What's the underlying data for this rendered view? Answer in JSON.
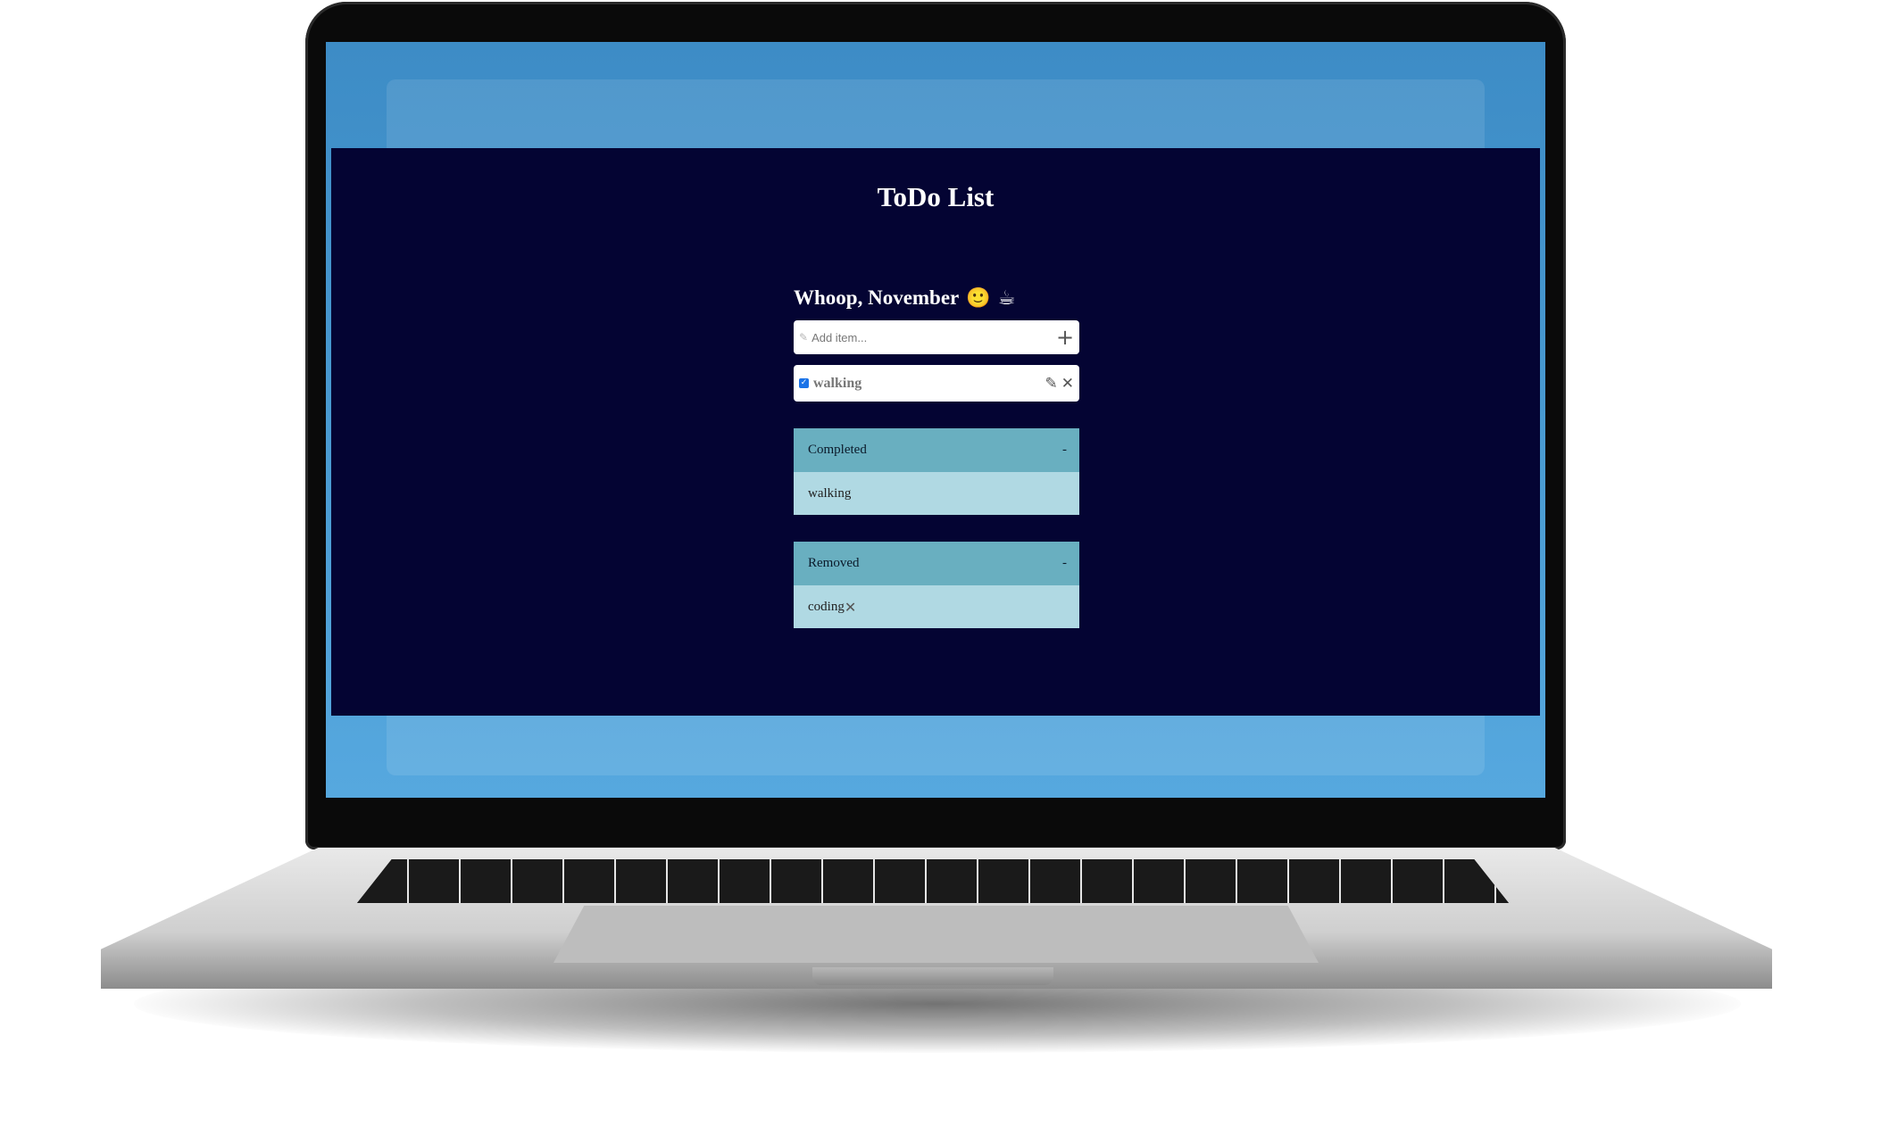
{
  "app": {
    "title": "ToDo List",
    "greeting": "Whoop, November",
    "greeting_icons": [
      "smiling-face-icon",
      "hot-beverage-icon"
    ],
    "accent_color": "#040433"
  },
  "add_item": {
    "placeholder": "Add item...",
    "value": ""
  },
  "todo_items": [
    {
      "label": "walking",
      "checked": true
    }
  ],
  "completed": {
    "title": "Completed",
    "toggle": "-",
    "items": [
      "walking"
    ]
  },
  "removed": {
    "title": "Removed",
    "toggle": "-",
    "items": [
      "coding"
    ]
  }
}
